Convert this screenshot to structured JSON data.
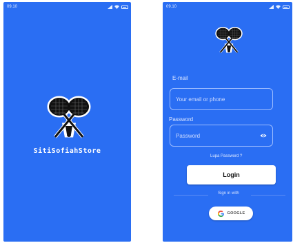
{
  "splash": {
    "status_time": "09.10",
    "store_name": "SitiSofiahStore"
  },
  "login": {
    "status_time": "09.10",
    "email_label": "E-mail",
    "email_placeholder": "Your email or phone",
    "password_label": "Password",
    "password_placeholder": "Password",
    "forgot_password": "Lupa Password ?",
    "login_button": "Login",
    "sign_in_with": "Sign in with",
    "google_button": "GOOGLE"
  },
  "colors": {
    "background_blue": "#2a6ef3",
    "button_white": "#ffffff",
    "logo_black": "#111111"
  },
  "icons": [
    "badminton-logo-icon",
    "eye-icon",
    "google-icon",
    "signal-icon",
    "wifi-icon",
    "battery-icon"
  ]
}
